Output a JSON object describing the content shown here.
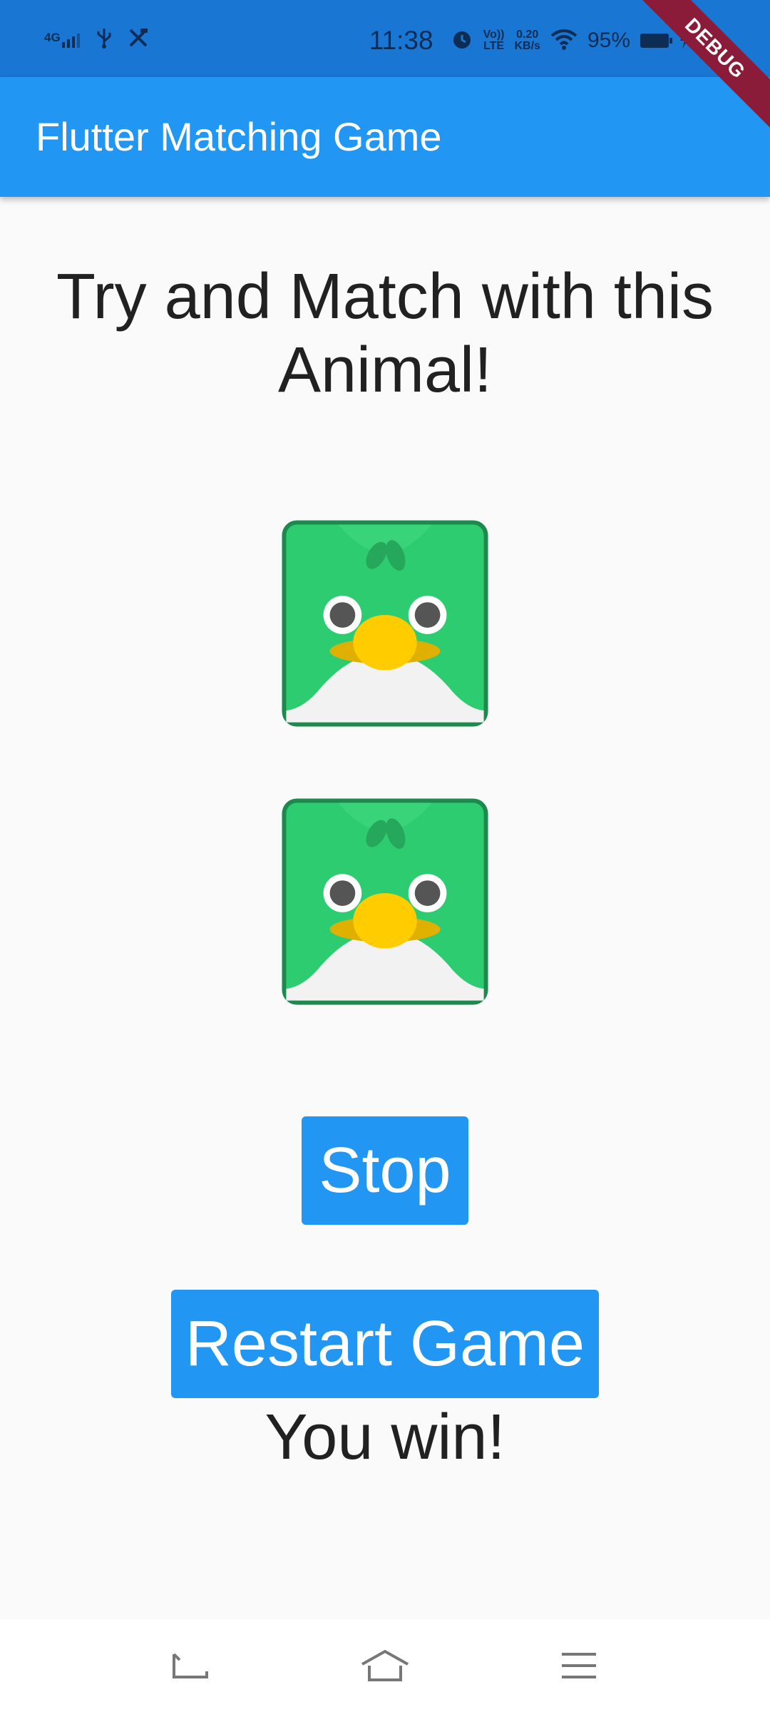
{
  "status_bar": {
    "network": "4G",
    "time": "11:38",
    "volte_top": "Vo))",
    "volte_bottom": "LTE",
    "speed_top": "0.20",
    "speed_bottom": "KB/s",
    "battery": "95%",
    "icons": [
      "signal-icon",
      "usb-icon",
      "tools-icon",
      "alarm-icon",
      "volte-icon",
      "wifi-icon",
      "battery-icon",
      "charging-icon"
    ]
  },
  "debug_banner": "DEBUG",
  "app_bar": {
    "title": "Flutter Matching Game"
  },
  "main": {
    "heading": "Try and Match with this Animal!",
    "tiles": [
      {
        "animal": "parrot",
        "icon": "parrot-icon"
      },
      {
        "animal": "parrot",
        "icon": "parrot-icon"
      }
    ],
    "stop_label": "Stop",
    "restart_label": "Restart Game",
    "result_text": "You win!"
  },
  "nav_bar": {
    "icons": [
      "back-icon",
      "home-icon",
      "menu-icon"
    ]
  },
  "colors": {
    "status_bar": "#1976d2",
    "app_bar": "#2196f3",
    "button": "#2196f3",
    "background": "#fafafa",
    "tile_green": "#2ecc71",
    "tile_border": "#1b8a4c",
    "beak": "#ffcc00"
  }
}
